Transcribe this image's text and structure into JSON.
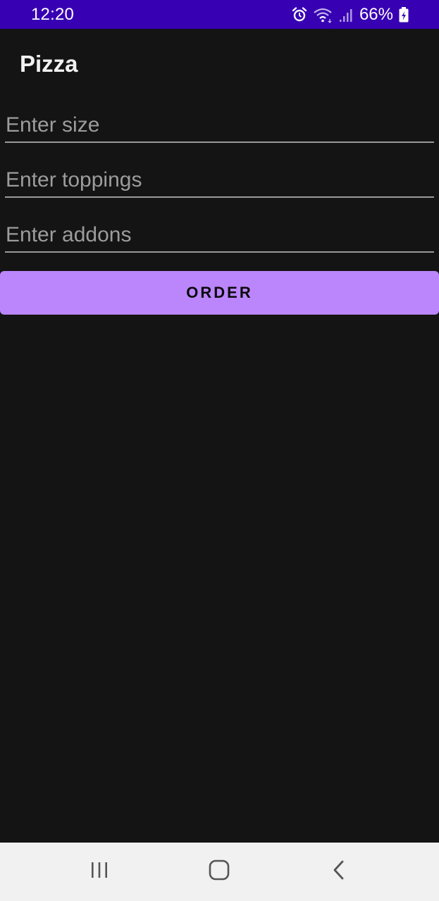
{
  "status_bar": {
    "time": "12:20",
    "battery_percent": "66%",
    "icons": [
      "alarm-icon",
      "wifi-icon",
      "signal-icon",
      "battery-charging-icon"
    ],
    "background": "#3700b3"
  },
  "app_bar": {
    "title": "Pizza"
  },
  "form": {
    "size_placeholder": "Enter size",
    "toppings_placeholder": "Enter toppings",
    "addons_placeholder": "Enter addons",
    "order_label": "ORDER",
    "accent": "#bb86fc"
  },
  "nav_bar": {
    "icons": [
      "recent-apps-icon",
      "home-icon",
      "back-icon"
    ]
  }
}
